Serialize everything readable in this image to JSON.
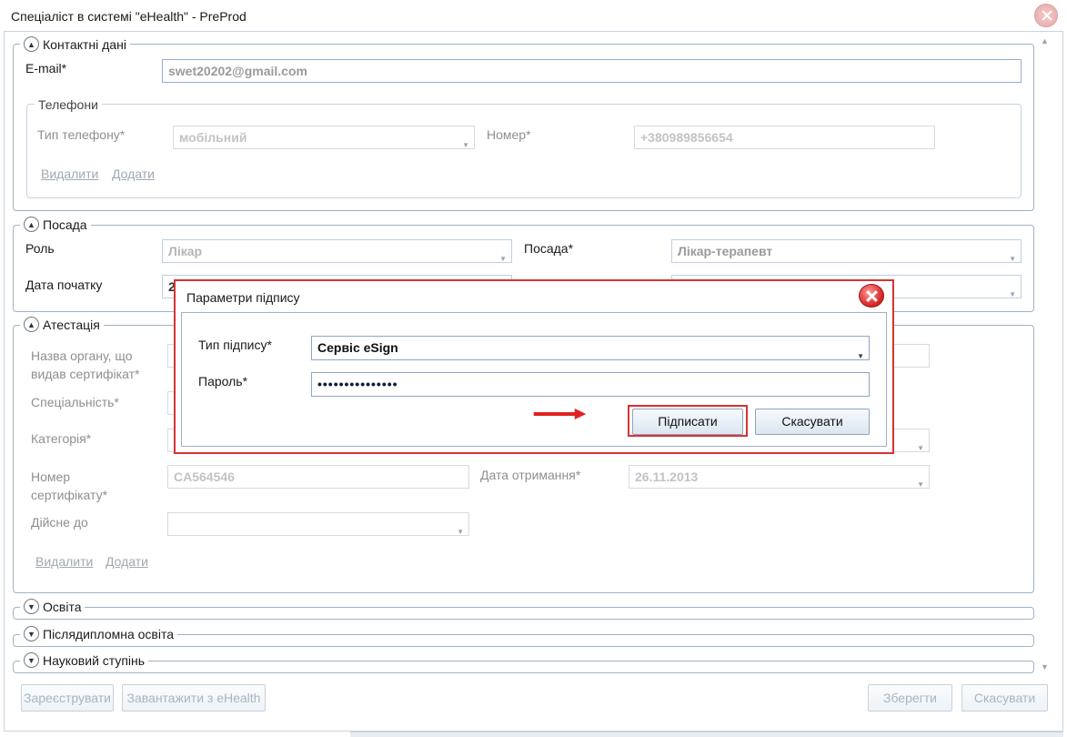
{
  "window": {
    "title": "Спеціаліст в системі \"eHealth\" - PreProd"
  },
  "contacts": {
    "title": "Контактні дані",
    "email_label": "E-mail*",
    "email_value": "swet20202@gmail.com",
    "phones": {
      "title": "Телефони",
      "type_label": "Тип телефону*",
      "type_value": "мобільний",
      "number_label": "Номер*",
      "number_value": "+380989856654",
      "delete": "Видалити",
      "add": "Додати"
    }
  },
  "position": {
    "title": "Посада",
    "role_label": "Роль",
    "role_value": "Лікар",
    "post_label": "Посада*",
    "post_value": "Лікар-терапевт",
    "start_label": "Дата початку",
    "start_value": "2"
  },
  "attestation": {
    "title": "Атестація",
    "org_label": "Назва органу, що видав сертифікат*",
    "specialty_label": "Спеціальність*",
    "category_label": "Категорія*",
    "cert_label": "Номер сертифікату*",
    "cert_value": "CA564546",
    "received_label": "Дата отримання*",
    "received_value": "26.11.2013",
    "valid_label": "Дійсне до",
    "delete": "Видалити",
    "add": "Додати"
  },
  "education": {
    "title": "Освіта"
  },
  "postgrad": {
    "title": "Післядипломна освіта"
  },
  "degree": {
    "title": "Науковий ступінь"
  },
  "footer": {
    "register": "Зареєструвати",
    "load": "Завантажити з eHealth",
    "save": "Зберегти",
    "cancel": "Скасувати"
  },
  "dialog": {
    "title": "Параметри підпису",
    "sign_type_label": "Тип підпису*",
    "sign_type_value": "Сервіс eSign",
    "password_label": "Пароль*",
    "password_value": "•••••••••••••••",
    "sign_button": "Підписати",
    "cancel_button": "Скасувати",
    "highlight_color": "#d63333"
  }
}
